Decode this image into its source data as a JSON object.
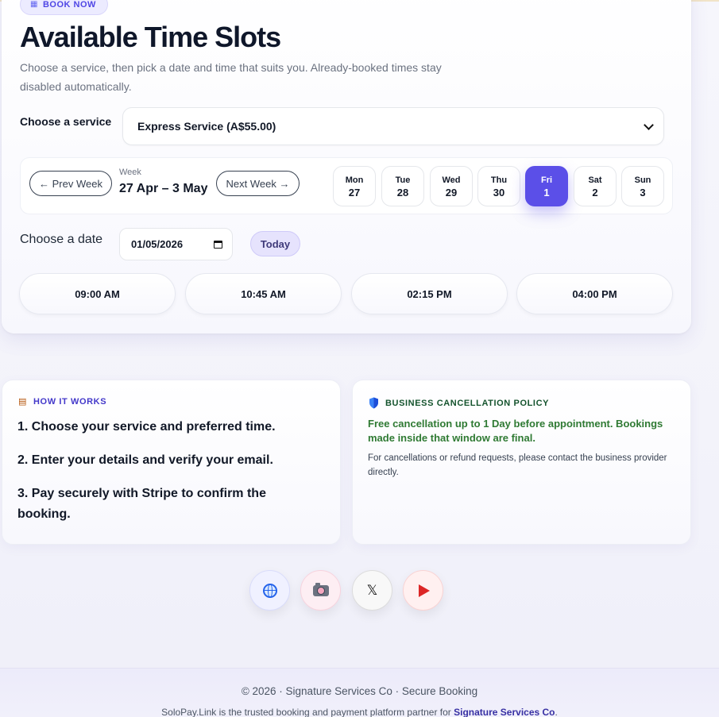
{
  "badge": {
    "label": "BOOK NOW",
    "icon": "calendar-icon"
  },
  "header": {
    "title": "Available Time Slots",
    "subtitle": "Choose a service, then pick a date and time that suits you. Already-booked times stay disabled automatically."
  },
  "service": {
    "label": "Choose a service",
    "selected": "Express Service (A$55.00)"
  },
  "week": {
    "prev_label": "← Prev Week",
    "next_label": "Next Week →",
    "caption": "Week",
    "range": "27 Apr – 3 May",
    "days": [
      {
        "name": "Mon",
        "date": "27",
        "selected": false
      },
      {
        "name": "Tue",
        "date": "28",
        "selected": false
      },
      {
        "name": "Wed",
        "date": "29",
        "selected": false
      },
      {
        "name": "Thu",
        "date": "30",
        "selected": false
      },
      {
        "name": "Fri",
        "date": "1",
        "selected": true
      },
      {
        "name": "Sat",
        "date": "2",
        "selected": false
      },
      {
        "name": "Sun",
        "date": "3",
        "selected": false
      }
    ]
  },
  "date": {
    "label": "Choose a date",
    "value": "01/05/2026",
    "today_label": "Today"
  },
  "slots": [
    "09:00 AM",
    "10:45 AM",
    "02:15 PM",
    "04:00 PM"
  ],
  "how_it_works": {
    "heading": "HOW IT WORKS",
    "steps": [
      "1. Choose your service and preferred time.",
      "2. Enter your details and verify your email.",
      "3. Pay securely with Stripe to confirm the booking."
    ]
  },
  "policy": {
    "heading": "BUSINESS CANCELLATION POLICY",
    "strong": "Free cancellation up to 1 Day before appointment. Bookings made inside that window are final.",
    "note": "For cancellations or refund requests, please contact the business provider directly."
  },
  "social": {
    "x_glyph": "𝕏"
  },
  "footer": {
    "line1": "© 2026 · Signature Services Co · Secure Booking",
    "line2_prefix": "SoloPay.Link is the trusted booking and payment platform partner for ",
    "line2_business": "Signature Services Co",
    "line2_suffix": "."
  },
  "colors": {
    "accent": "#5b4fe8",
    "policy_green": "#2f7a33",
    "heading_indigo": "#4338ca"
  }
}
